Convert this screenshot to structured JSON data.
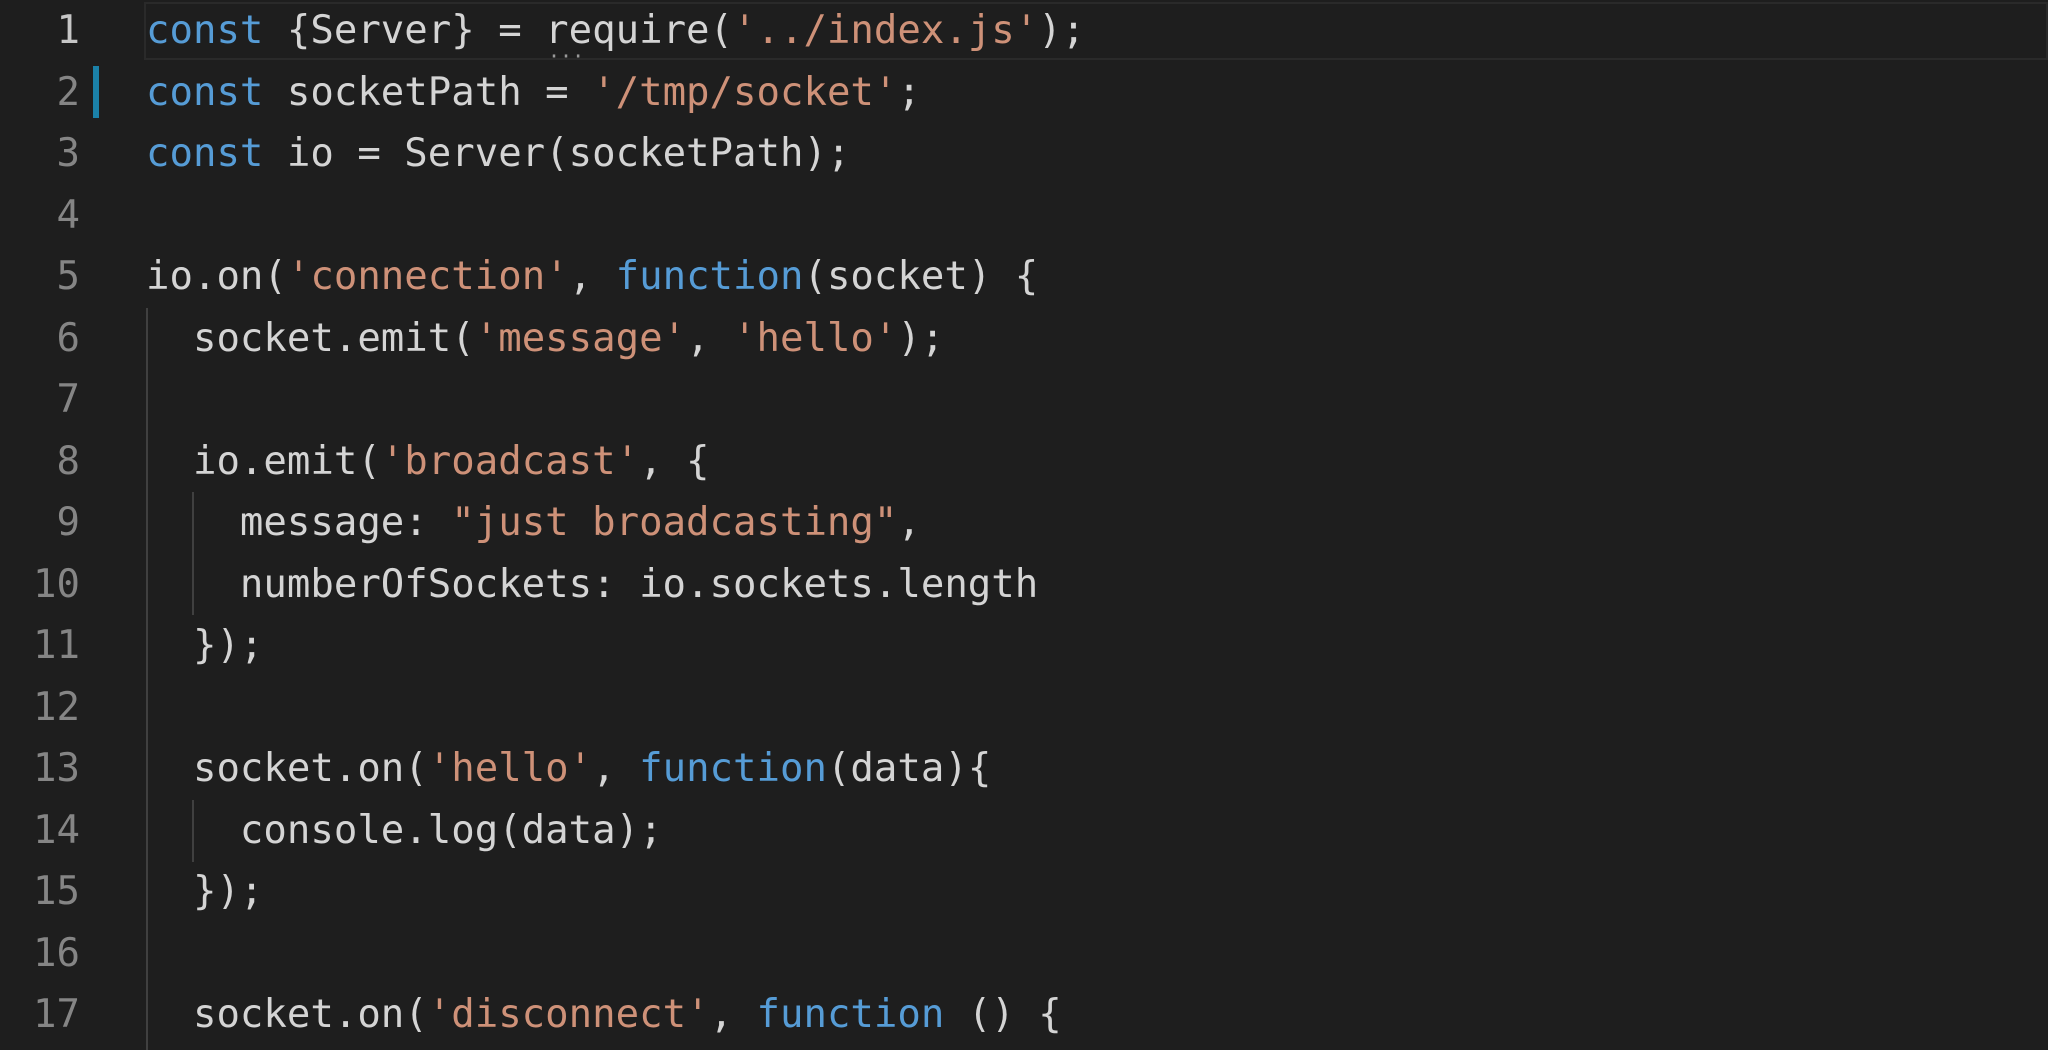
{
  "editor": {
    "lines": [
      {
        "number": "1",
        "active": true,
        "modified": false,
        "tokens": [
          {
            "t": "kw",
            "v": "const"
          },
          {
            "t": "id",
            "v": " {Server} = "
          },
          {
            "t": "id",
            "v": "require("
          },
          {
            "t": "str",
            "v": "'../index.js'"
          },
          {
            "t": "id",
            "v": ");"
          }
        ]
      },
      {
        "number": "2",
        "active": false,
        "modified": true,
        "tokens": [
          {
            "t": "kw",
            "v": "const"
          },
          {
            "t": "id",
            "v": " socketPath = "
          },
          {
            "t": "str",
            "v": "'/tmp/socket'"
          },
          {
            "t": "id",
            "v": ";"
          }
        ]
      },
      {
        "number": "3",
        "active": false,
        "modified": false,
        "tokens": [
          {
            "t": "kw",
            "v": "const"
          },
          {
            "t": "id",
            "v": " io = Server(socketPath);"
          }
        ]
      },
      {
        "number": "4",
        "active": false,
        "modified": false,
        "tokens": []
      },
      {
        "number": "5",
        "active": false,
        "modified": false,
        "tokens": [
          {
            "t": "id",
            "v": "io.on("
          },
          {
            "t": "str",
            "v": "'connection'"
          },
          {
            "t": "id",
            "v": ", "
          },
          {
            "t": "kw",
            "v": "function"
          },
          {
            "t": "id",
            "v": "(socket) {"
          }
        ]
      },
      {
        "number": "6",
        "active": false,
        "modified": false,
        "tokens": [
          {
            "t": "id",
            "v": "  socket.emit("
          },
          {
            "t": "str",
            "v": "'message'"
          },
          {
            "t": "id",
            "v": ", "
          },
          {
            "t": "str",
            "v": "'hello'"
          },
          {
            "t": "id",
            "v": ");"
          }
        ]
      },
      {
        "number": "7",
        "active": false,
        "modified": false,
        "tokens": []
      },
      {
        "number": "8",
        "active": false,
        "modified": false,
        "tokens": [
          {
            "t": "id",
            "v": "  io.emit("
          },
          {
            "t": "str",
            "v": "'broadcast'"
          },
          {
            "t": "id",
            "v": ", {"
          }
        ]
      },
      {
        "number": "9",
        "active": false,
        "modified": false,
        "tokens": [
          {
            "t": "id",
            "v": "    message: "
          },
          {
            "t": "str",
            "v": "\"just broadcasting\""
          },
          {
            "t": "id",
            "v": ","
          }
        ]
      },
      {
        "number": "10",
        "active": false,
        "modified": false,
        "tokens": [
          {
            "t": "id",
            "v": "    numberOfSockets: io.sockets.length"
          }
        ]
      },
      {
        "number": "11",
        "active": false,
        "modified": false,
        "tokens": [
          {
            "t": "id",
            "v": "  });"
          }
        ]
      },
      {
        "number": "12",
        "active": false,
        "modified": false,
        "tokens": []
      },
      {
        "number": "13",
        "active": false,
        "modified": false,
        "tokens": [
          {
            "t": "id",
            "v": "  socket.on("
          },
          {
            "t": "str",
            "v": "'hello'"
          },
          {
            "t": "id",
            "v": ", "
          },
          {
            "t": "kw",
            "v": "function"
          },
          {
            "t": "id",
            "v": "(data){"
          }
        ]
      },
      {
        "number": "14",
        "active": false,
        "modified": false,
        "tokens": [
          {
            "t": "id",
            "v": "    console.log(data);"
          }
        ]
      },
      {
        "number": "15",
        "active": false,
        "modified": false,
        "tokens": [
          {
            "t": "id",
            "v": "  });"
          }
        ]
      },
      {
        "number": "16",
        "active": false,
        "modified": false,
        "tokens": []
      },
      {
        "number": "17",
        "active": false,
        "modified": false,
        "tokens": [
          {
            "t": "id",
            "v": "  socket.on("
          },
          {
            "t": "str",
            "v": "'disconnect'"
          },
          {
            "t": "id",
            "v": ", "
          },
          {
            "t": "kw",
            "v": "function"
          },
          {
            "t": "id",
            "v": " () {"
          }
        ]
      }
    ]
  },
  "colors": {
    "background": "#1e1e1e",
    "keyword": "#569cd6",
    "string": "#ce9178",
    "identifier": "#d4d4d4",
    "line_number": "#858585",
    "modified_marker": "#1b81a8"
  }
}
